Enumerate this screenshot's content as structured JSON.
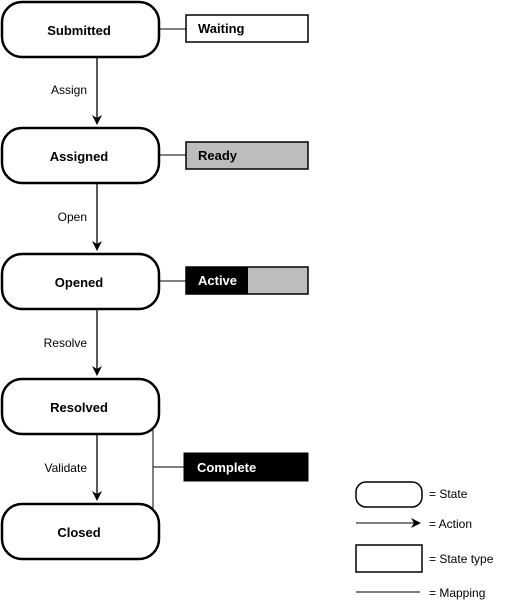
{
  "states": [
    {
      "id": "submitted",
      "label": "Submitted"
    },
    {
      "id": "assigned",
      "label": "Assigned"
    },
    {
      "id": "opened",
      "label": "Opened"
    },
    {
      "id": "resolved",
      "label": "Resolved"
    },
    {
      "id": "closed",
      "label": "Closed"
    }
  ],
  "actions": [
    {
      "label": "Assign",
      "from": "submitted",
      "to": "assigned"
    },
    {
      "label": "Open",
      "from": "assigned",
      "to": "opened"
    },
    {
      "label": "Resolve",
      "from": "opened",
      "to": "resolved"
    },
    {
      "label": "Validate",
      "from": "resolved",
      "to": "closed"
    }
  ],
  "state_types": [
    {
      "label": "Waiting",
      "style": "white",
      "maps": [
        "submitted"
      ]
    },
    {
      "label": "Ready",
      "style": "gray",
      "maps": [
        "assigned"
      ]
    },
    {
      "label": "Active",
      "style": "split",
      "maps": [
        "opened"
      ]
    },
    {
      "label": "Complete",
      "style": "black",
      "maps": [
        "resolved",
        "closed"
      ]
    }
  ],
  "colors": {
    "gray": "#bdbdbd",
    "black": "#000000",
    "white": "#ffffff"
  },
  "legend": {
    "state": "= State",
    "action": "= Action",
    "state_type": "= State type",
    "mapping": "= Mapping"
  }
}
